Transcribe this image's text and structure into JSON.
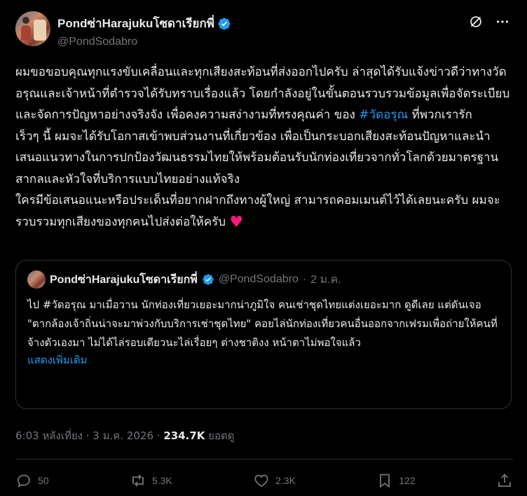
{
  "author": {
    "display_name": "Pondซ่าHarajukuโซดาเรียกพี่",
    "handle": "@PondSodabro"
  },
  "post": {
    "text_part1": "ผมขอขอบคุณทุกแรงขับเคลื่อนและทุกเสียงสะท้อนที่ส่งออกไปครับ ล่าสุดได้รับแจ้งข่าวดีว่าทางวัดอรุณและเจ้าหน้าที่ตำรวจได้รับทราบเรื่องแล้ว โดยกำลังอยู่ในขั้นตอนรวบรวมข้อมูลเพื่อจัดระเบียบและจัดการปัญหาอย่างจริงจัง เพื่อคงความสง่างามที่ทรงคุณค่า ของ ",
    "hashtag": "#วัดอรุณ",
    "text_part2": " ที่พวกเรารัก\nเร็วๆ นี้ ผมจะได้รับโอกาสเข้าพบส่วนงานที่เกี่ยวข้อง เพื่อเป็นกระบอกเสียงสะท้อนปัญหาและนำเสนอแนวทางในการปกป้องวัฒนธรรมไทยให้พร้อมต้อนรับนักท่องเที่ยวจากทั่วโลกด้วยมาตรฐานสากลและหัวใจที่บริการแบบไทยอย่างแท้จริง\nใครมีข้อเสนอแนะหรือประเด็นที่อยากฝากถึงทางผู้ใหญ่ สามารถคอมเมนต์ไว้ได้เลยนะครับ ผมจะรวบรวมทุกเสียงของทุกคนไปส่งต่อให้ครับ ",
    "heart": "♥"
  },
  "quote": {
    "display_name": "Pondซ่าHarajukuโซดาเรียกพี่",
    "handle": "@PondSodabro",
    "dot": "·",
    "date": "2 ม.ค.",
    "text": "ไป #วัดอรุณ มาเมื่อวาน นักท่องเที่ยวเยอะมากน่าภูมิใจ คนเช่าชุดไทยแต่งเยอะมาก ดูดีเลย แต่ดันเจอ\n\"ตากล้องเจ้าถิ่นน่าจะมาพ่วงกับบริการเช่าชุดไทย\" คอยไล่นักท่องเที่ยวคนอื่นออกจากเฟรมเพื่อถ่ายให้คนที่จ้างตัวเองมา ไม่ได้ไล่รอบเดียวนะไล่เรื่อยๆ ต่างชาติงง หน้าตาไม่พอใจแล้ว",
    "show_more": "แสดงเพิ่มเติม"
  },
  "meta": {
    "time_date": "6:03 หลังเที่ยง · 3 ม.ค. 2026 · ",
    "views": "234.7K",
    "views_label": " ยอดดู"
  },
  "actions": {
    "replies": "50",
    "reposts": "5.3K",
    "likes": "2.3K",
    "bookmarks": "122"
  },
  "colors": {
    "background": "#000000",
    "text": "#e7e9ea",
    "secondary": "#71767b",
    "accent": "#1d9bf0",
    "heart": "#f91880",
    "border": "#2f3336"
  },
  "icons": [
    "verified-badge-icon",
    "grok-icon",
    "more-icon",
    "reply-icon",
    "repost-icon",
    "like-icon",
    "bookmark-icon",
    "share-icon"
  ]
}
